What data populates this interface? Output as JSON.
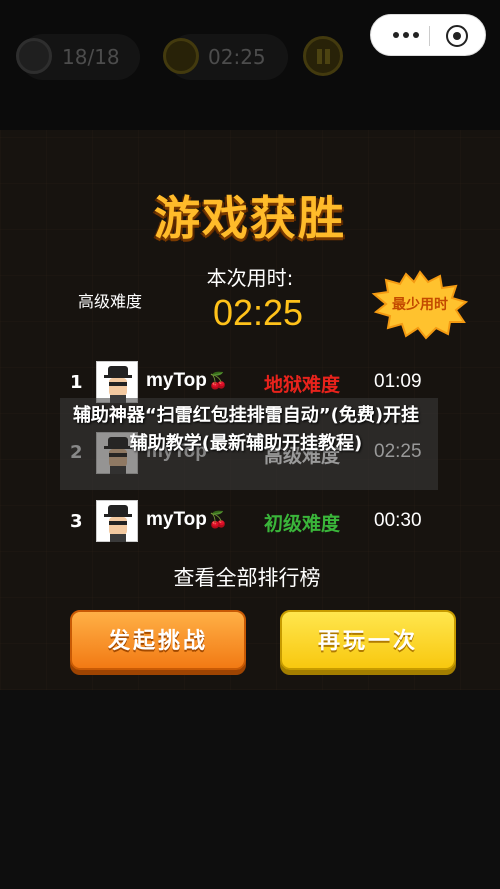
{
  "hud": {
    "mines": "18/18",
    "time": "02:25",
    "mine_icon": "mine-icon",
    "clock_icon": "clock-icon",
    "pause_icon": "pause-icon"
  },
  "capsule": {
    "more_icon": "more-icon",
    "close_icon": "target-icon"
  },
  "result": {
    "title": "游戏获胜",
    "used_label": "本次用时:",
    "difficulty": "高级难度",
    "time": "02:25",
    "badge": "最少用时"
  },
  "leaderboard": [
    {
      "rank": "1",
      "name": "myTop",
      "level": "地狱难度",
      "level_color": "#e8231c",
      "time": "01:09"
    },
    {
      "rank": "2",
      "name": "myTop",
      "level": "高级难度",
      "level_color": "#9a9a9a",
      "time": "02:25"
    },
    {
      "rank": "3",
      "name": "myTop",
      "level": "初级难度",
      "level_color": "#3ab53a",
      "time": "00:30"
    }
  ],
  "headline": "辅助神器“扫雷红包挂排雷自动”(免费)开挂辅助教学(最新辅助开挂教程)",
  "view_all": "查看全部排行榜",
  "buttons": {
    "challenge": "发起挑战",
    "replay": "再玩一次"
  },
  "colors": {
    "title": "#ffbb2a",
    "time": "#ffc21a",
    "challenge_button": "#f58a1f",
    "replay_button": "#fad324"
  }
}
